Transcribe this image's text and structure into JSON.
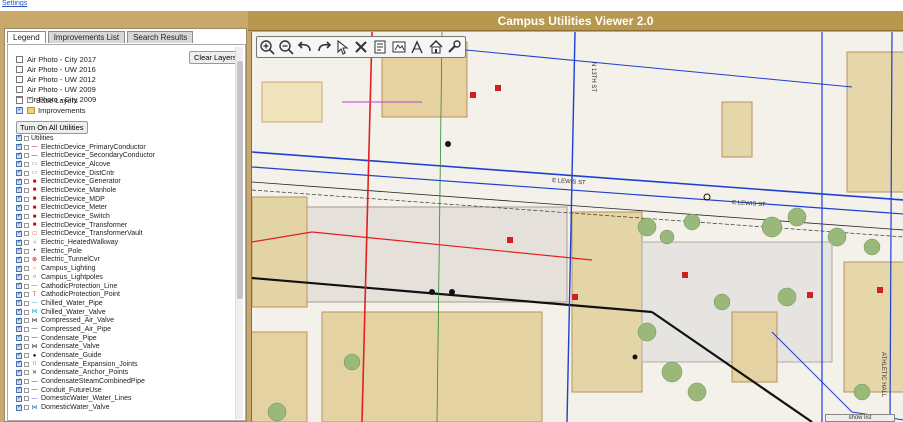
{
  "settings_link": "Settings",
  "title": "Campus Utilities Viewer 2.0",
  "tabs": [
    "Legend",
    "Improvements List",
    "Search Results"
  ],
  "clear_layers": "Clear Layers",
  "air_photos": [
    "Air Photo - City 2017",
    "Air Photo - UW 2016",
    "Air Photo - UW 2012",
    "Air Photo - UW 2009",
    "Air Photo - City 2009"
  ],
  "base_layers": "Base Layers",
  "improvements": "Improvements",
  "turn_on_all": "Turn On All Utilities",
  "utilities": "Utilities",
  "layers": [
    "ElectricDevice_PrimaryConductor",
    "ElectricDevice_SecondaryConductor",
    "ElectricDevice_Alcove",
    "ElectricDevice_DistCntr",
    "ElectricDevice_Generator",
    "ElectricDevice_Manhole",
    "ElectricDevice_MDP",
    "ElectricDevice_Meter",
    "ElectricDevice_Switch",
    "ElectricDevice_Transformer",
    "ElectricDevice_TransformerVault",
    "Electric_HeatedWalkway",
    "Electric_Pole",
    "Electric_TunnelCvr",
    "Campus_Lighting",
    "Campus_Lightpoles",
    "CathodicProtection_Line",
    "CathodicProtection_Point",
    "Chilled_Water_Pipe",
    "Chilled_Water_Valve",
    "Compressed_Air_Valve",
    "Compressed_Air_Pipe",
    "Condensate_Pipe",
    "Condensate_Valve",
    "Condensate_Guide",
    "Condensate_Expansion_Joints",
    "Condensate_Anchor_Points",
    "CondensateSteamCombinedPipe",
    "Conduit_FutureUse",
    "DomesticWater_Water_Lines",
    "DomesticWater_Valve"
  ],
  "street_labels": [
    "E LEWIS ST",
    "E LEWIS ST",
    "N 13TH ST",
    "ATHLETIC HALL"
  ],
  "toolbar_icons": [
    "zoom-in-icon",
    "zoom-out-icon",
    "undo-icon",
    "redo-icon",
    "pointer-icon",
    "clear-icon",
    "print-icon",
    "identify-icon",
    "measure-icon",
    "home-icon",
    "tools-icon"
  ],
  "status_text": "show list"
}
